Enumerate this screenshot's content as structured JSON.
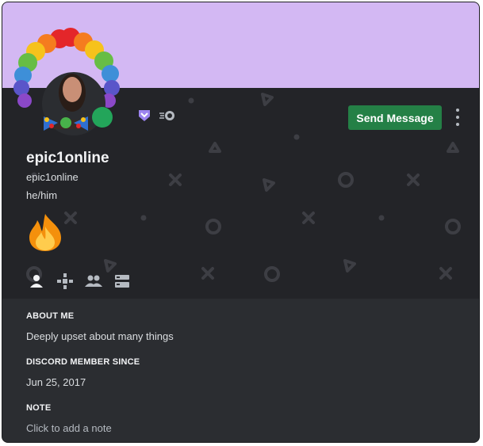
{
  "profile": {
    "display_name": "epic1online",
    "username": "epic1online",
    "pronouns": "he/him",
    "status": "online",
    "banner_color": "#d3b8f3",
    "status_color": "#23a55a",
    "custom_emoji": "fire"
  },
  "actions": {
    "send_message_label": "Send Message",
    "more_icon": "vertical-ellipsis-icon"
  },
  "badges": [
    "hypesquad-icon",
    "nitro-icon"
  ],
  "tabs": [
    "user-info-icon",
    "activity-icon",
    "mutual-friends-icon",
    "mutual-servers-icon"
  ],
  "sections": {
    "about_me_title": "ABOUT ME",
    "about_me_text": "Deeply upset about many things",
    "member_since_title": "DISCORD MEMBER SINCE",
    "member_since_text": "Jun 25, 2017",
    "note_title": "NOTE",
    "note_placeholder": "Click to add a note"
  },
  "colors": {
    "accent_button": "#248046",
    "card_bg": "#232428",
    "section_bg": "#2b2d31"
  }
}
